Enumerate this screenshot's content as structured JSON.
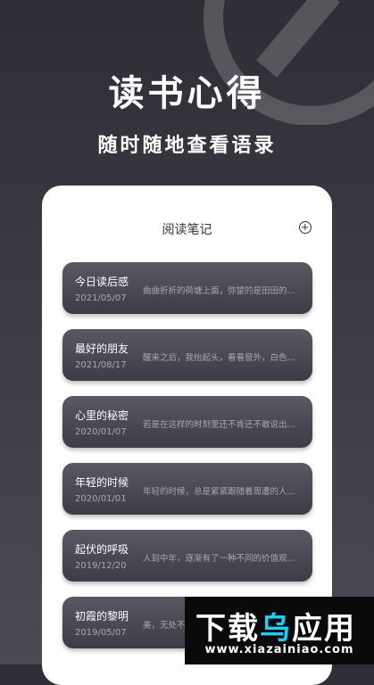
{
  "hero": {
    "title": "读书心得",
    "subtitle": "随时随地查看语录"
  },
  "notes_screen": {
    "title": "阅读笔记",
    "add_icon": "plus-circle-icon"
  },
  "notes": [
    {
      "title": "今日读后感",
      "date": "2021/05/07",
      "preview": "曲曲折折的荷塘上面，弥望的是田田的..."
    },
    {
      "title": "最好的朋友",
      "date": "2021/08/17",
      "preview": "醒来之后，我抬起头，看看窗外，白色..."
    },
    {
      "title": "心里的秘密",
      "date": "2020/01/07",
      "preview": "若是在这样的时刻里还不肯还不敢说出..."
    },
    {
      "title": "年轻的时候",
      "date": "2020/01/01",
      "preview": "年轻的时候，总是紧紧跟随着周遭的人..."
    },
    {
      "title": "起伏的呼吸",
      "date": "2019/12/20",
      "preview": "人到中年，逐渐有了一种不同的价值观..."
    },
    {
      "title": "初霞的黎明",
      "date": "2019/05/07",
      "preview": "美，无处不"
    }
  ],
  "watermark": {
    "part1": "下载",
    "part2": "乌",
    "part3": "应用",
    "url": "www.xiazainiao.com"
  }
}
